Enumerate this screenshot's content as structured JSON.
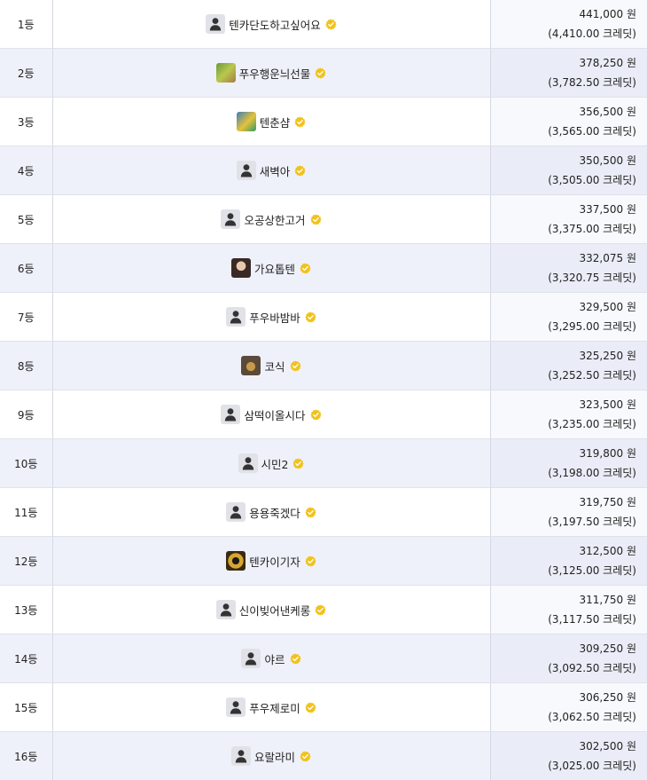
{
  "rankings": [
    {
      "rank": "1등",
      "name": "텐카단도하고싶어요",
      "avatar": "default",
      "won": "441,000 원",
      "credit": "(4,410.00 크레딧)"
    },
    {
      "rank": "2등",
      "name": "푸우행운늬선물",
      "avatar": "img1",
      "won": "378,250 원",
      "credit": "(3,782.50 크레딧)"
    },
    {
      "rank": "3등",
      "name": "텐춘샴",
      "avatar": "img2",
      "won": "356,500 원",
      "credit": "(3,565.00 크레딧)"
    },
    {
      "rank": "4등",
      "name": "새벽아",
      "avatar": "default",
      "won": "350,500 원",
      "credit": "(3,505.00 크레딧)"
    },
    {
      "rank": "5등",
      "name": "오공상한고거",
      "avatar": "default",
      "won": "337,500 원",
      "credit": "(3,375.00 크레딧)"
    },
    {
      "rank": "6등",
      "name": "가요톱텐",
      "avatar": "img3",
      "won": "332,075 원",
      "credit": "(3,320.75 크레딧)"
    },
    {
      "rank": "7등",
      "name": "푸우바밤바",
      "avatar": "default",
      "won": "329,500 원",
      "credit": "(3,295.00 크레딧)"
    },
    {
      "rank": "8등",
      "name": "코식",
      "avatar": "img4",
      "won": "325,250 원",
      "credit": "(3,252.50 크레딧)"
    },
    {
      "rank": "9등",
      "name": "삼떡이올시다",
      "avatar": "default",
      "won": "323,500 원",
      "credit": "(3,235.00 크레딧)"
    },
    {
      "rank": "10등",
      "name": "시민2",
      "avatar": "default",
      "won": "319,800 원",
      "credit": "(3,198.00 크레딧)"
    },
    {
      "rank": "11등",
      "name": "용용죽겠다",
      "avatar": "default",
      "won": "319,750 원",
      "credit": "(3,197.50 크레딧)"
    },
    {
      "rank": "12등",
      "name": "텐카이기자",
      "avatar": "img5",
      "won": "312,500 원",
      "credit": "(3,125.00 크레딧)"
    },
    {
      "rank": "13등",
      "name": "신이빚어낸케롱",
      "avatar": "default",
      "won": "311,750 원",
      "credit": "(3,117.50 크레딧)"
    },
    {
      "rank": "14등",
      "name": "야르",
      "avatar": "default",
      "won": "309,250 원",
      "credit": "(3,092.50 크레딧)"
    },
    {
      "rank": "15등",
      "name": "푸우제로미",
      "avatar": "default",
      "won": "306,250 원",
      "credit": "(3,062.50 크레딧)"
    },
    {
      "rank": "16등",
      "name": "요랄라미",
      "avatar": "default",
      "won": "302,500 원",
      "credit": "(3,025.00 크레딧)"
    }
  ],
  "colors": {
    "badge": "#f2c21b",
    "row_alt": "#eff1fa",
    "border": "#d6d9e3"
  },
  "icons": {
    "default_avatar": "user-silhouette-icon",
    "badge": "verified-badge-icon"
  }
}
